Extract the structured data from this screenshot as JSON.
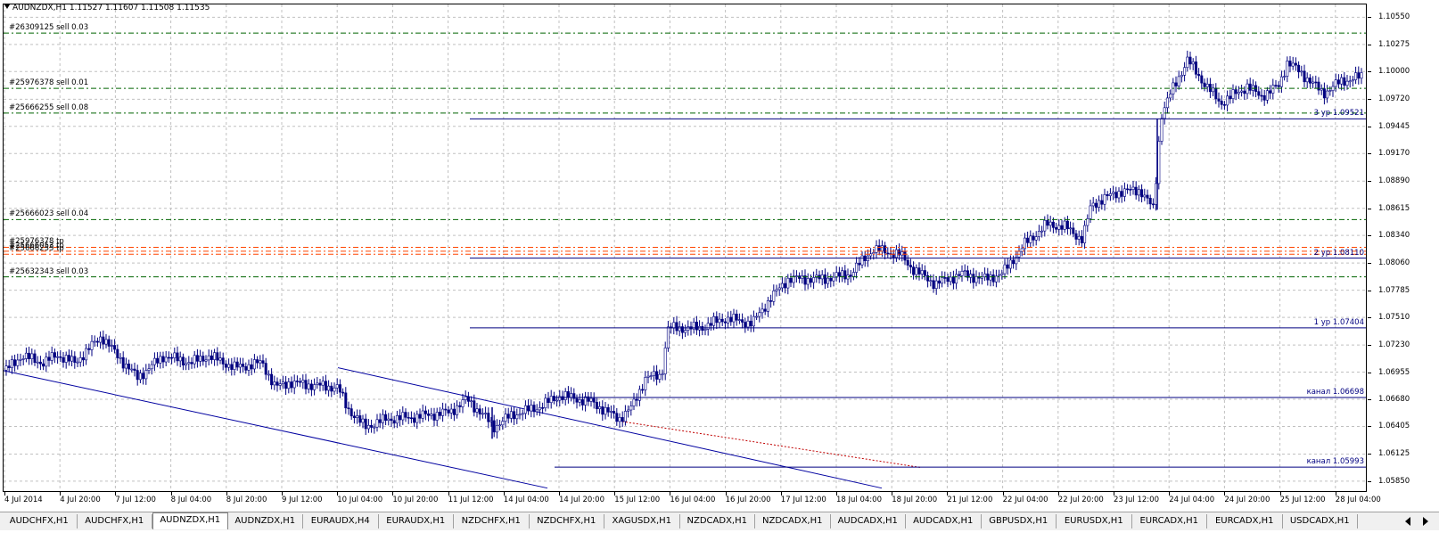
{
  "window": {
    "symbol_line": "AUDNZDX,H1  1.11527 1.11607 1.11508 1.11535"
  },
  "colors": {
    "candle_up": "#000080",
    "candle_down": "#000080",
    "order_sell_line": "#006400",
    "tp_line": "#ff4500",
    "level_line": "#000080",
    "channel_line": "#0000a0",
    "projection_line": "#c00000",
    "grid": "#c0c0c0"
  },
  "price_axis": {
    "min": 1.0575,
    "max": 1.1068,
    "ticks": [
      "1.10550",
      "1.10275",
      "1.10000",
      "1.09720",
      "1.09445",
      "1.09170",
      "1.08890",
      "1.08615",
      "1.08340",
      "1.08060",
      "1.07785",
      "1.07510",
      "1.07230",
      "1.06955",
      "1.06680",
      "1.06405",
      "1.06125",
      "1.05850"
    ]
  },
  "time_axis": {
    "ticks": [
      "4 Jul 2014",
      "4 Jul 20:00",
      "7 Jul 12:00",
      "8 Jul 04:00",
      "8 Jul 20:00",
      "9 Jul 12:00",
      "10 Jul 04:00",
      "10 Jul 20:00",
      "11 Jul 12:00",
      "14 Jul 04:00",
      "14 Jul 20:00",
      "15 Jul 12:00",
      "16 Jul 04:00",
      "16 Jul 20:00",
      "17 Jul 12:00",
      "18 Jul 04:00",
      "18 Jul 20:00",
      "21 Jul 12:00",
      "22 Jul 04:00",
      "22 Jul 20:00",
      "23 Jul 12:00",
      "24 Jul 04:00",
      "24 Jul 20:00",
      "25 Jul 12:00",
      "28 Jul 04:00"
    ]
  },
  "order_lines": [
    {
      "label": "#26309125 sell 0.03",
      "price": 1.1039
    },
    {
      "label": "#25976378 sell 0.01",
      "price": 1.0983
    },
    {
      "label": "#25666255 sell 0.08",
      "price": 1.0958
    },
    {
      "label": "#25666023 sell 0.04",
      "price": 1.085
    },
    {
      "label": "#25632343 sell 0.03",
      "price": 1.0792
    }
  ],
  "tp_lines": [
    {
      "label": "#25976378 tp",
      "price": 1.0822
    },
    {
      "label": "#25666053 tp",
      "price": 1.0818
    },
    {
      "label": "#25666255 tp",
      "price": 1.0815
    }
  ],
  "level_lines": [
    {
      "label": "3 ур 1.09521",
      "price": 1.09521
    },
    {
      "label": "2 ур 1.08110",
      "price": 1.0811
    },
    {
      "label": "1 ур 1.07404",
      "price": 1.07404
    },
    {
      "label": "канал 1.06698",
      "price": 1.06698
    },
    {
      "label": "канал 1.05993",
      "price": 1.05993
    }
  ],
  "tabs": [
    {
      "label": "AUDCHFX,H1",
      "active": false
    },
    {
      "label": "AUDCHFX,H1",
      "active": false
    },
    {
      "label": "AUDNZDX,H1",
      "active": true
    },
    {
      "label": "AUDNZDX,H1",
      "active": false
    },
    {
      "label": "EURAUDX,H4",
      "active": false
    },
    {
      "label": "EURAUDX,H1",
      "active": false
    },
    {
      "label": "NZDCHFX,H1",
      "active": false
    },
    {
      "label": "NZDCHFX,H1",
      "active": false
    },
    {
      "label": "XAGUSDX,H1",
      "active": false
    },
    {
      "label": "NZDCADX,H1",
      "active": false
    },
    {
      "label": "NZDCADX,H1",
      "active": false
    },
    {
      "label": "AUDCADX,H1",
      "active": false
    },
    {
      "label": "AUDCADX,H1",
      "active": false
    },
    {
      "label": "GBPUSDX,H1",
      "active": false
    },
    {
      "label": "EURUSDX,H1",
      "active": false
    },
    {
      "label": "EURCADX,H1",
      "active": false
    },
    {
      "label": "EURCADX,H1",
      "active": false
    },
    {
      "label": "USDCADX,H1",
      "active": false
    }
  ]
}
